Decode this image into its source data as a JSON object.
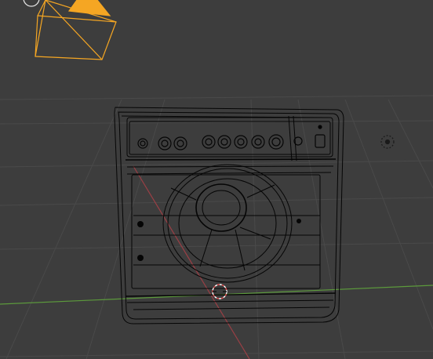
{
  "viewport": {
    "view": "3D Viewport",
    "shading": "wireframe"
  },
  "scene": {
    "objects": [
      {
        "kind": "camera",
        "name": "camera-icon"
      },
      {
        "kind": "mesh",
        "name": "amplifier-mesh"
      },
      {
        "kind": "light",
        "name": "light-icon"
      },
      {
        "kind": "cursor",
        "name": "3d-cursor-icon"
      }
    ]
  },
  "colors": {
    "background": "#3d3d3d",
    "grid": "#4a4a4a",
    "x_axis": "#9a3f45",
    "y_axis": "#5c9a3c",
    "wire": "#050505",
    "camera": "#f5a623",
    "cursor_red": "#e05050",
    "cursor_white": "#ffffff"
  }
}
